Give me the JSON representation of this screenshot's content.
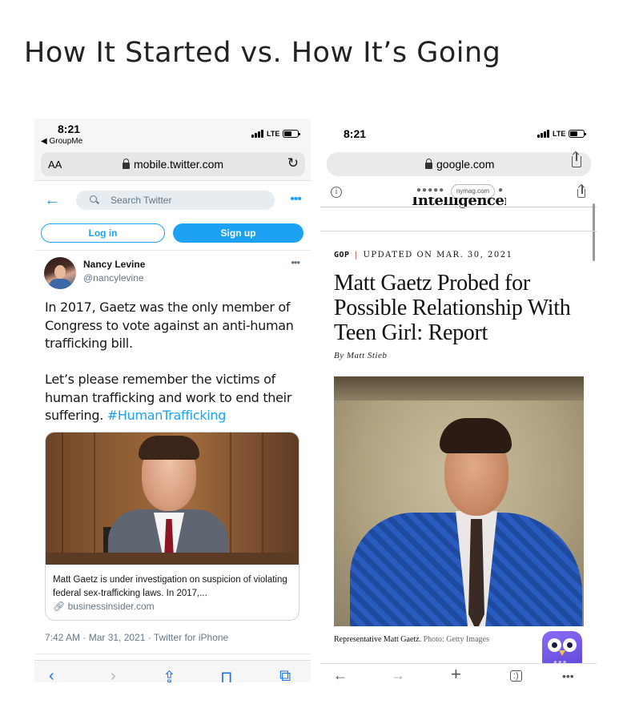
{
  "meme": {
    "title": "How It Started vs. How It’s Going"
  },
  "left_phone": {
    "status": {
      "time": "8:21",
      "back_app": "◀ GroupMe",
      "network": "LTE"
    },
    "address_bar": {
      "text_size": "AA",
      "url": "mobile.twitter.com"
    },
    "twitter_header": {
      "search_placeholder": "Search Twitter"
    },
    "auth": {
      "login_label": "Log in",
      "signup_label": "Sign up"
    },
    "tweet": {
      "author_name": "Nancy Levine",
      "author_handle": "@nancylevine",
      "paragraph1": "In 2017, Gaetz was the only member of Congress to vote against an anti-human trafficking bill.",
      "paragraph2": "Let’s please remember the victims of human trafficking and work to end their suffering.",
      "hashtag": "#HumanTrafficking",
      "card_text": "Matt Gaetz is under investigation on suspicion of violating federal sex-trafficking laws. In 2017,...",
      "card_domain": "businessinsider.com",
      "meta": "7:42 AM · Mar 31, 2021 · Twitter for iPhone"
    },
    "toolbar": {
      "back": "‹",
      "forward": "›",
      "share": "⇪",
      "bookmarks": "⊓",
      "tabs": "⧉"
    }
  },
  "right_phone": {
    "status": {
      "time": "8:21",
      "network": "LTE"
    },
    "address_bar": {
      "url": "google.com"
    },
    "sub_bar": {
      "dots_left": "●●●●●",
      "pill": "nymag.com",
      "dot_right": "●"
    },
    "masthead": "Intelligencer",
    "article": {
      "kicker_tag": "GOP",
      "kicker_separator": "|",
      "kicker_date": "UPDATED ON MAR. 30, 2021",
      "headline": "Matt Gaetz Probed for Possible Relationship With Teen Girl: Report",
      "byline": "By Matt Stieb",
      "caption_main": "Representative Matt Gaetz.",
      "caption_credit": "Photo: Getty Images"
    },
    "toolbar": {
      "back": "←",
      "forward": "→",
      "add": "+",
      "tabs": ":)",
      "more": "•••"
    }
  },
  "colors": {
    "twitter_blue": "#1da1f2",
    "suit_blue": "#2a5cc0",
    "owl_purple": "#7b5cf0"
  }
}
